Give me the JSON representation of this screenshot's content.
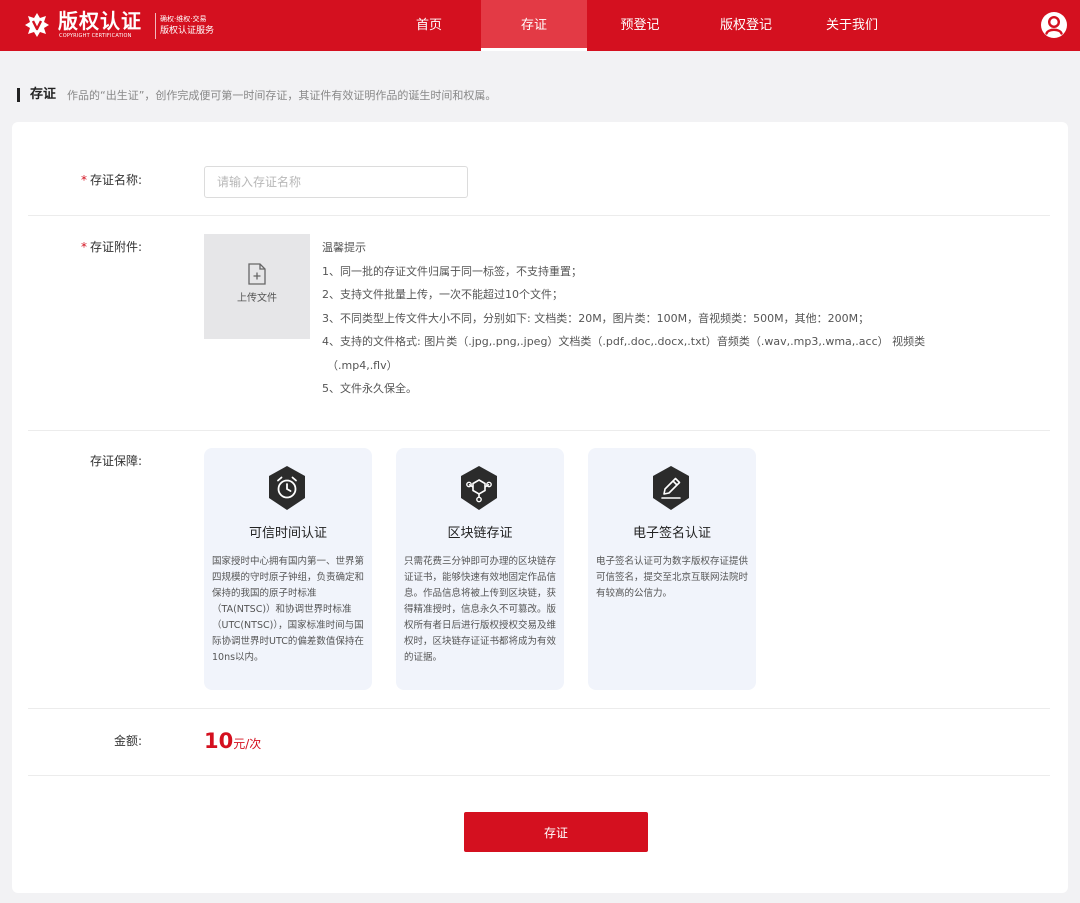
{
  "header": {
    "brand_title": "版权认证",
    "brand_subtitle": "COPYRIGHT CERTIFICATION",
    "brand_tagline": "确权·维权·交易",
    "brand_service": "版权认证服务",
    "nav": [
      {
        "label": "首页",
        "active": false
      },
      {
        "label": "存证",
        "active": true
      },
      {
        "label": "预登记",
        "active": false
      },
      {
        "label": "版权登记",
        "active": false
      },
      {
        "label": "关于我们",
        "active": false
      }
    ],
    "accent_color": "#d4101f"
  },
  "page": {
    "title": "存证",
    "description": "作品的“出生证”，创作完成便可第一时间存证，其证件有效证明作品的诞生时间和权属。"
  },
  "form": {
    "name": {
      "required_mark": "*",
      "label": "存证名称:",
      "value": "",
      "placeholder": "请输入存证名称"
    },
    "attachment": {
      "required_mark": "*",
      "label": "存证附件:",
      "upload_label": "上传文件",
      "tips_title": "温馨提示",
      "tips": [
        "1、同一批的存证文件归属于同一标签，不支持重置；",
        "2、支持文件批量上传，一次不能超过10个文件；",
        "3、不同类型上传文件大小不同，分别如下: 文档类：20M，图片类：100M，音视频类：500M，其他：200M；",
        "4、支持的文件格式: 图片类（.jpg,.png,.jpeg）文档类（.pdf,.doc,.docx,.txt）音频类（.wav,.mp3,.wma,.acc） 视频类",
        "（.mp4,.flv）",
        "5、文件永久保全。"
      ]
    },
    "guarantee": {
      "label": "存证保障:",
      "features": [
        {
          "icon": "clock-icon",
          "title": "可信时间认证",
          "desc": "国家授时中心拥有国内第一、世界第四规模的守时原子钟组，负责确定和保持的我国的原子时标准（TA(NTSC)）和协调世界时标准（UTC(NTSC)），国家标准时间与国际协调世界时UTC的偏差数值保持在10ns以内。"
        },
        {
          "icon": "blockchain-icon",
          "title": "区块链存证",
          "desc": "只需花费三分钟即可办理的区块链存证证书，能够快速有效地固定作品信息。作品信息将被上传到区块链，获得精准授时，信息永久不可篡改。版权所有者日后进行版权授权交易及维权时，区块链存证证书都将成为有效的证据。"
        },
        {
          "icon": "signature-pen-icon",
          "title": "电子签名认证",
          "desc": "电子签名认证可为数字版权存证提供可信签名，提交至北京互联网法院时有较高的公信力。"
        }
      ]
    },
    "amount": {
      "label": "金额:",
      "value": "10",
      "unit": "元/次"
    },
    "submit_label": "存证"
  }
}
